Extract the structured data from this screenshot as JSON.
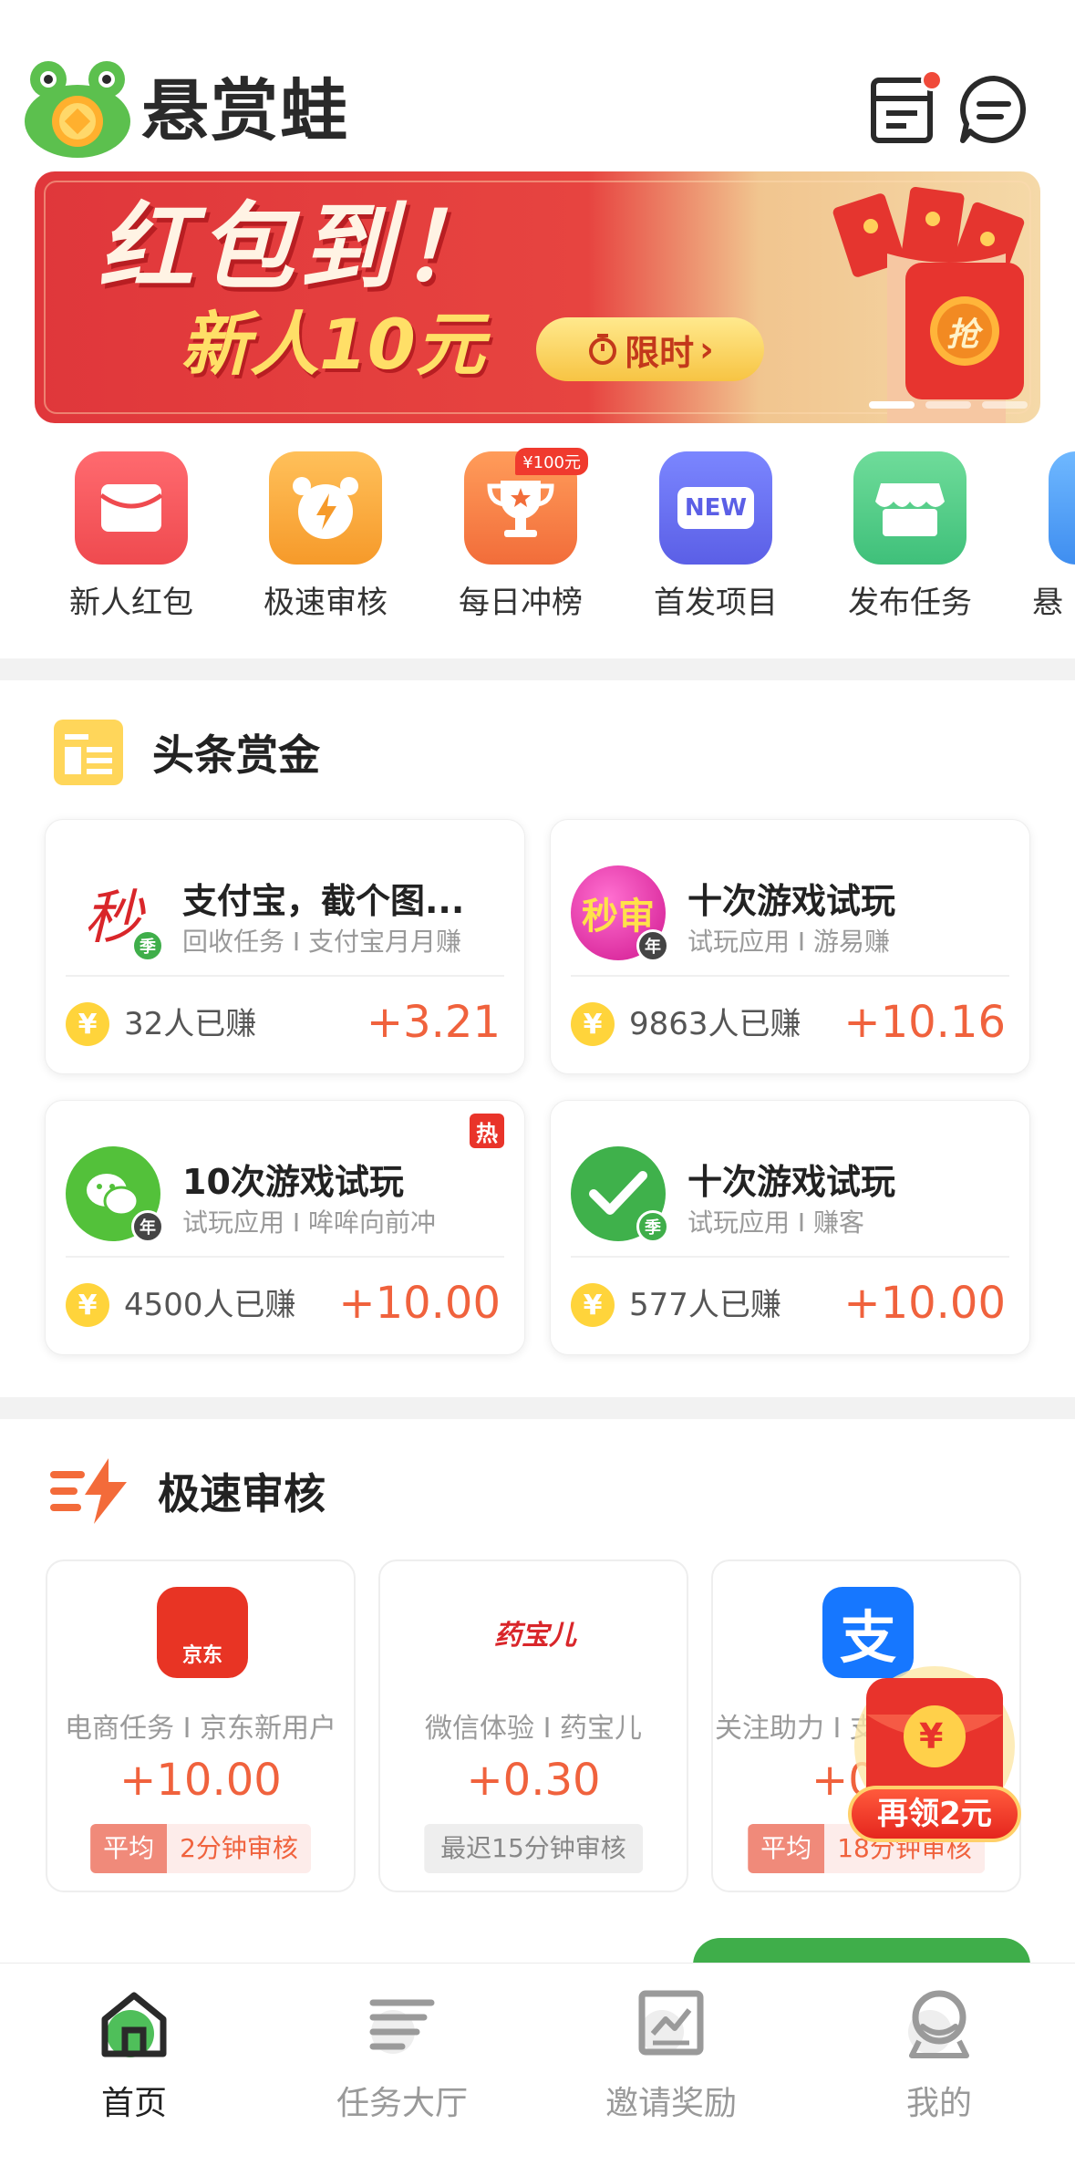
{
  "header": {
    "app_name": "悬赏蛙"
  },
  "banner": {
    "title": "红包到！",
    "subtitle": "新人10元",
    "button_label": "限时",
    "envelope_text": "抢"
  },
  "quick_actions": [
    {
      "label": "新人红包"
    },
    {
      "label": "极速审核"
    },
    {
      "label": "每日冲榜",
      "badge": "¥100元"
    },
    {
      "label": "首发项目",
      "icon_text": "NEW"
    },
    {
      "label": "发布任务"
    },
    {
      "label": "悬"
    }
  ],
  "headline": {
    "title": "头条赏金",
    "cards": [
      {
        "logo_text": "秒",
        "logo_badge": "季",
        "title": "支付宝，截个图...",
        "subtitle": "回收任务 I 支付宝月月赚",
        "coin": "¥",
        "count": "32人已赚",
        "reward": "+3.21"
      },
      {
        "logo_text": "秒审",
        "logo_badge": "年",
        "title": "十次游戏试玩",
        "subtitle": "试玩应用 I 游易赚",
        "coin": "¥",
        "count": "9863人已赚",
        "reward": "+10.16"
      },
      {
        "logo_text": "",
        "logo_badge": "年",
        "title": "10次游戏试玩",
        "subtitle": "试玩应用 I 哞哞向前冲",
        "coin": "¥",
        "count": "4500人已赚",
        "reward": "+10.00",
        "hot": "热"
      },
      {
        "logo_text": "",
        "logo_badge": "季",
        "title": "十次游戏试玩",
        "subtitle": "试玩应用 I 赚客",
        "coin": "¥",
        "count": "577人已赚",
        "reward": "+10.00"
      }
    ]
  },
  "fast_review": {
    "title": "极速审核",
    "cards": [
      {
        "logo_text": "京东",
        "subtitle": "电商任务 I 京东新用户",
        "reward": "+10.00",
        "tag_a": "平均",
        "tag_b": "2分钟审核"
      },
      {
        "logo_text": "药宝儿",
        "subtitle": "微信体验 I 药宝儿",
        "reward": "+0.30",
        "tag_grey": "最迟15分钟审核"
      },
      {
        "logo_text": "支",
        "subtitle": "关注助力 I 支",
        "reward": "+0",
        "tag_a": "平均",
        "tag_b": "18分钟审核"
      }
    ]
  },
  "floating_envelope": {
    "coin": "¥",
    "label": "再领2元"
  },
  "bottom_nav": [
    {
      "label": "首页",
      "active": true
    },
    {
      "label": "任务大厅"
    },
    {
      "label": "邀请奖励"
    },
    {
      "label": "我的"
    }
  ],
  "colors": {
    "brand_green": "#3fae4a",
    "reward_orange": "#f0623d",
    "banner_red": "#e0373b",
    "coin_yellow": "#ffd43b"
  }
}
